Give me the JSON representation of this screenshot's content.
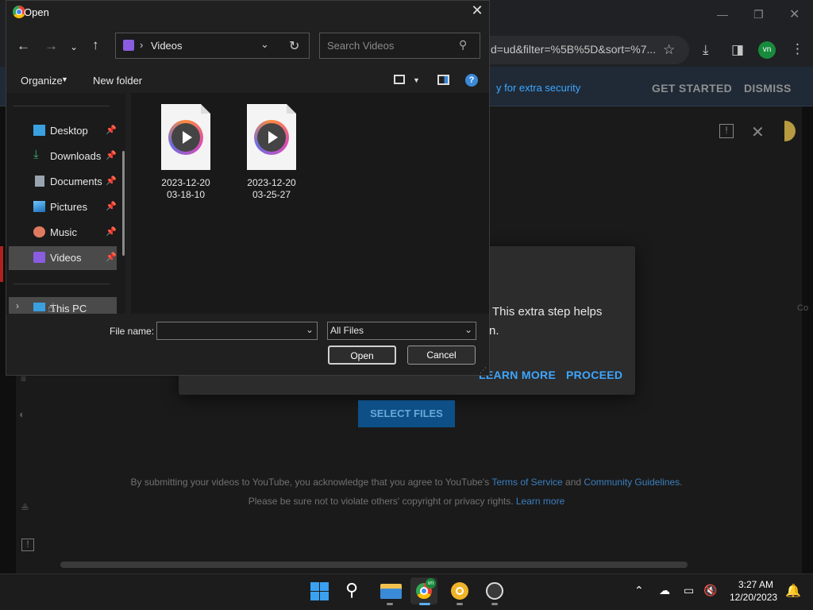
{
  "browser": {
    "url": "d=ud&filter=%5B%5D&sort=%7...",
    "profile_initials": "vn",
    "security_banner": "y for extra security",
    "get_started": "GET STARTED",
    "dismiss": "DISMISS"
  },
  "youtube": {
    "consent_line1": "This extra step helps",
    "consent_line2": "n.",
    "learn_more": "LEARN MORE",
    "proceed": "PROCEED",
    "select_files": "SELECT FILES",
    "legal_pre": "By submitting your videos to YouTube, you acknowledge that you agree to YouTube's ",
    "terms": "Terms of Service",
    "and": " and ",
    "guidelines": "Community Guidelines",
    "legal_post": ".",
    "copyright": "Please be sure not to violate others' copyright or privacy rights. ",
    "learn_more_link": "Learn more",
    "right_clip": "Co"
  },
  "dialog": {
    "title": "Open",
    "path": "Videos",
    "search_placeholder": "Search Videos",
    "organize": "Organize",
    "new_folder": "New folder",
    "sidebar": [
      {
        "label": "Desktop",
        "icon": "desktop-icon",
        "color": "#3aa0e0",
        "pinned": true
      },
      {
        "label": "Downloads",
        "icon": "download-icon",
        "color": "#3ab070",
        "pinned": true
      },
      {
        "label": "Documents",
        "icon": "documents-icon",
        "color": "#9aa4b0",
        "pinned": true
      },
      {
        "label": "Pictures",
        "icon": "pictures-icon",
        "color": "#3a9ad8",
        "pinned": true
      },
      {
        "label": "Music",
        "icon": "music-icon",
        "color": "#e07a5f",
        "pinned": true
      },
      {
        "label": "Videos",
        "icon": "videos-icon",
        "color": "#8a5ce0",
        "pinned": true
      }
    ],
    "this_pc": "This PC",
    "files": [
      {
        "line1": "2023-12-20",
        "line2": "03-18-10"
      },
      {
        "line1": "2023-12-20",
        "line2": "03-25-27"
      }
    ],
    "file_name_label": "File name:",
    "file_name_value": "",
    "file_type": "All Files",
    "open_button": "Open",
    "cancel_button": "Cancel"
  },
  "taskbar": {
    "time": "3:27 AM",
    "date": "12/20/2023"
  }
}
